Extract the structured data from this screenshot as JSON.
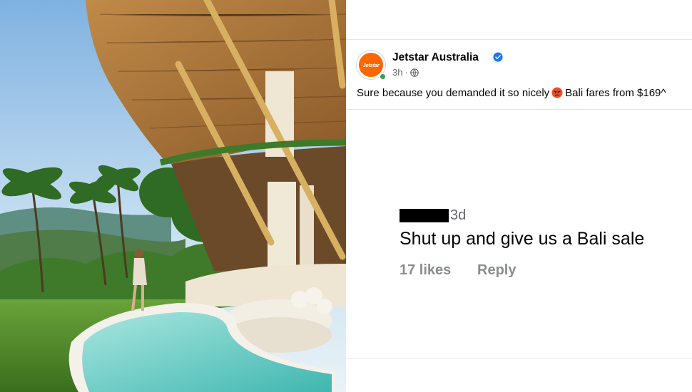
{
  "post": {
    "page_name": "Jetstar Australia",
    "avatar_text": "Jetstar",
    "time": "3h",
    "separator": "·",
    "text_before_emoji": "Sure because you demanded it so nicely",
    "text_after_emoji": "Bali fares from $169^",
    "icons": {
      "verified": "verified-badge-icon",
      "audience": "globe-icon",
      "emoji": "angry-face-emoji"
    }
  },
  "comment": {
    "time": "3d",
    "text": "Shut up and give us a Bali sale",
    "likes": "17 likes",
    "reply": "Reply"
  },
  "colors": {
    "brand": "#ff6600",
    "verified": "#1877f2",
    "secondary_text": "#65676b"
  }
}
